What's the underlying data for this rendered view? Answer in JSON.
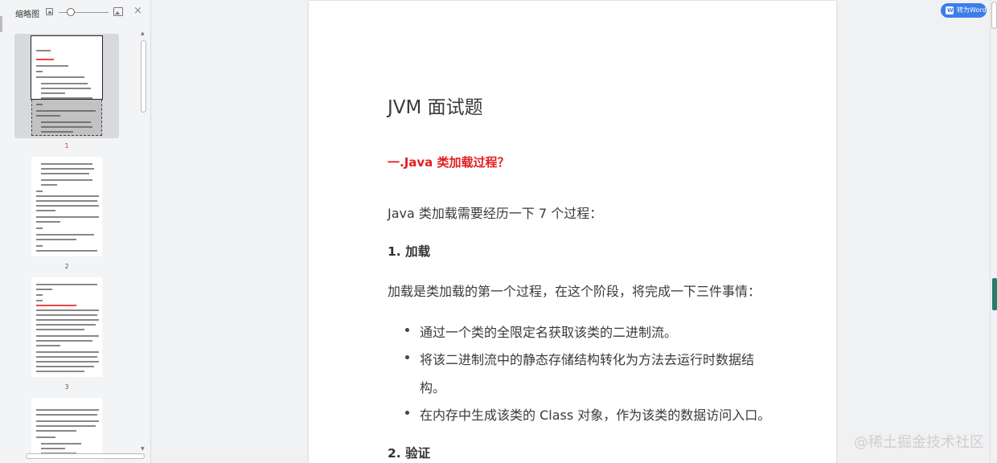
{
  "sidebar": {
    "title": "缩略图",
    "pages": [
      {
        "num": "1",
        "active": true
      },
      {
        "num": "2",
        "active": false
      },
      {
        "num": "3",
        "active": false
      }
    ]
  },
  "toolbar": {
    "to_word_label": "转为Word"
  },
  "document": {
    "title": "JVM 面试题",
    "heading1": "一.Java  类加载过程？",
    "intro": "Java  类加载需要经历一下  7  个过程：",
    "section1": "1.  加载",
    "section1_desc": "加载是类加载的第一个过程，在这个阶段，将完成一下三件事情：",
    "bullets": [
      "通过一个类的全限定名获取该类的二进制流。",
      "将该二进制流中的静态存储结构转化为方法去运行时数据结",
      "构。",
      "在内存中生成该类的  Class  对象，作为该类的数据访问入口。"
    ],
    "section2": "2.  验证"
  },
  "watermark": "@稀土掘金技术社区",
  "colors": {
    "accent": "#3d7dea",
    "heading_red": "#e41d1d"
  }
}
